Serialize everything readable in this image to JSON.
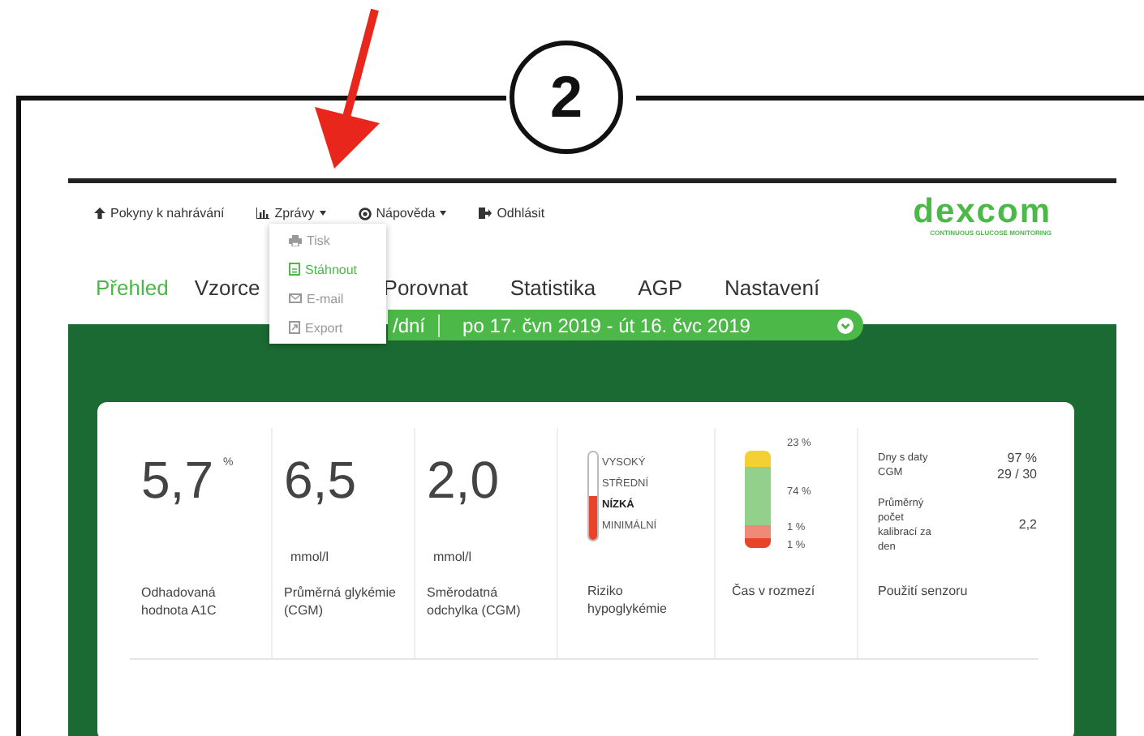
{
  "callout": {
    "number": "2"
  },
  "nav": [
    {
      "label": "Pokyny k nahrávání",
      "kind": "upload",
      "caret": false
    },
    {
      "label": "Zprávy",
      "kind": "reports",
      "caret": true,
      "menu": [
        {
          "label": "Tisk",
          "kind": "print",
          "selected": false
        },
        {
          "label": "Stáhnout",
          "kind": "download",
          "selected": true
        },
        {
          "label": "E-mail",
          "kind": "email",
          "selected": false
        },
        {
          "label": "Export",
          "kind": "export",
          "selected": false
        }
      ]
    },
    {
      "label": "Nápověda",
      "kind": "help",
      "caret": true
    },
    {
      "label": "Odhlásit",
      "kind": "logout",
      "caret": false
    }
  ],
  "logo": {
    "name": "dexcom",
    "tagline": "CONTINUOUS GLUCOSE MONITORING"
  },
  "tabs": [
    {
      "label": "Přehled",
      "selected": true
    },
    {
      "label": "Vzorce",
      "selected": false
    },
    {
      "label": "Porovnat",
      "selected": false
    },
    {
      "label": "Statistika",
      "selected": false
    },
    {
      "label": "AGP",
      "selected": false
    },
    {
      "label": "Nastavení",
      "selected": false
    }
  ],
  "date_bar": {
    "period": "/dní",
    "range": "po 17. čvn 2019 - út 16. čvc 2019"
  },
  "metrics": [
    {
      "kind": "value",
      "value": "5,7",
      "superscript": "%",
      "label": "Odhadovaná hodnota A1C"
    },
    {
      "kind": "value",
      "value": "6,5",
      "unit": "mmol/l",
      "label": "Průměrná glykémie (CGM)"
    },
    {
      "kind": "value",
      "value": "2,0",
      "unit": "mmol/l",
      "label": "Směrodatná odchylka (CGM)"
    },
    {
      "kind": "risk",
      "level": 0.5,
      "levels": [
        {
          "label": "VYSOKÝ",
          "selected": false
        },
        {
          "label": "STŘEDNÍ",
          "selected": false
        },
        {
          "label": "NÍZKÁ",
          "selected": true
        },
        {
          "label": "MINIMÁLNÍ",
          "selected": false
        }
      ],
      "label": "Riziko hypoglykémie"
    },
    {
      "kind": "range",
      "segments": [
        {
          "reading": "23 %",
          "color": "#f5d033"
        },
        {
          "reading": "74 %",
          "color": "#93d08c"
        },
        {
          "reading": "1 %",
          "color": "#f08a78"
        },
        {
          "reading": "1 %",
          "color": "#e8442a"
        }
      ],
      "label": "Čas v rozmezí"
    },
    {
      "kind": "usage",
      "rows": [
        {
          "label": "Dny s daty CGM",
          "values": [
            "97 %",
            "29 / 30"
          ]
        },
        {
          "label": "Průměrný počet kalibrací za den",
          "values": [
            "2,2"
          ]
        }
      ],
      "label": "Použití senzoru"
    }
  ]
}
